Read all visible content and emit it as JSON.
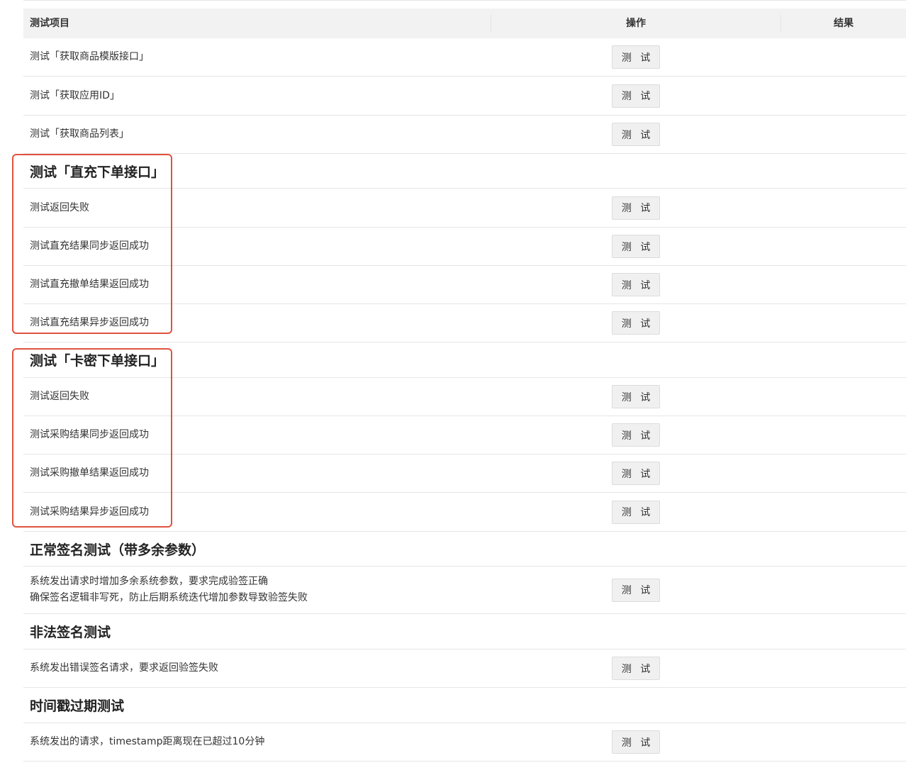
{
  "header": {
    "item": "测试项目",
    "op": "操作",
    "result": "结果"
  },
  "button_label": "测 试",
  "basic_items": [
    "测试「获取商品模版接口」",
    "测试「获取应用ID」",
    "测试「获取商品列表」"
  ],
  "direct": {
    "title": "测试「直充下单接口」",
    "items": [
      "测试返回失败",
      "测试直充结果同步返回成功",
      "测试直充撤单结果返回成功",
      "测试直充结果异步返回成功"
    ]
  },
  "card": {
    "title": "测试「卡密下单接口」",
    "items": [
      "测试返回失败",
      "测试采购结果同步返回成功",
      "测试采购撤单结果返回成功",
      "测试采购结果异步返回成功"
    ]
  },
  "normal_sign": {
    "title": "正常签名测试（带多余参数）",
    "line1": "系统发出请求时增加多余系统参数，要求完成验签正确",
    "line2": "确保签名逻辑非写死，防止后期系统迭代增加参数导致验签失败"
  },
  "illegal_sign": {
    "title": "非法签名测试",
    "line1": "系统发出错误签名请求，要求返回验签失败"
  },
  "timestamp": {
    "title": "时间戳过期测试",
    "line1": "系统发出的请求，timestamp距离现在已超过10分钟"
  },
  "colors": {
    "highlight": "#e0533f",
    "header_bg": "#f2f2f2",
    "button_bg": "#f0f0f0"
  }
}
